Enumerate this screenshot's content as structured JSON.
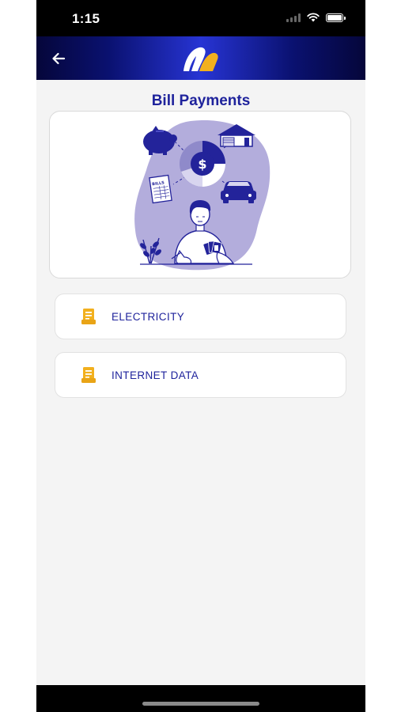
{
  "status_bar": {
    "time": "1:15"
  },
  "header": {
    "back_icon": "arrow-left-icon",
    "logo_icon": "brand-logo",
    "gradient_colors": [
      "#05063a",
      "#2734d4"
    ]
  },
  "page": {
    "title": "Bill Payments"
  },
  "illustration": {
    "bills_text": "BILLS"
  },
  "menu": {
    "items": [
      {
        "label": "ELECTRICITY",
        "icon": "receipt-icon"
      },
      {
        "label": "INTERNET DATA",
        "icon": "receipt-icon"
      }
    ]
  },
  "colors": {
    "primary": "#1f239c",
    "accent": "#f2b01e",
    "background": "#f4f4f4"
  }
}
